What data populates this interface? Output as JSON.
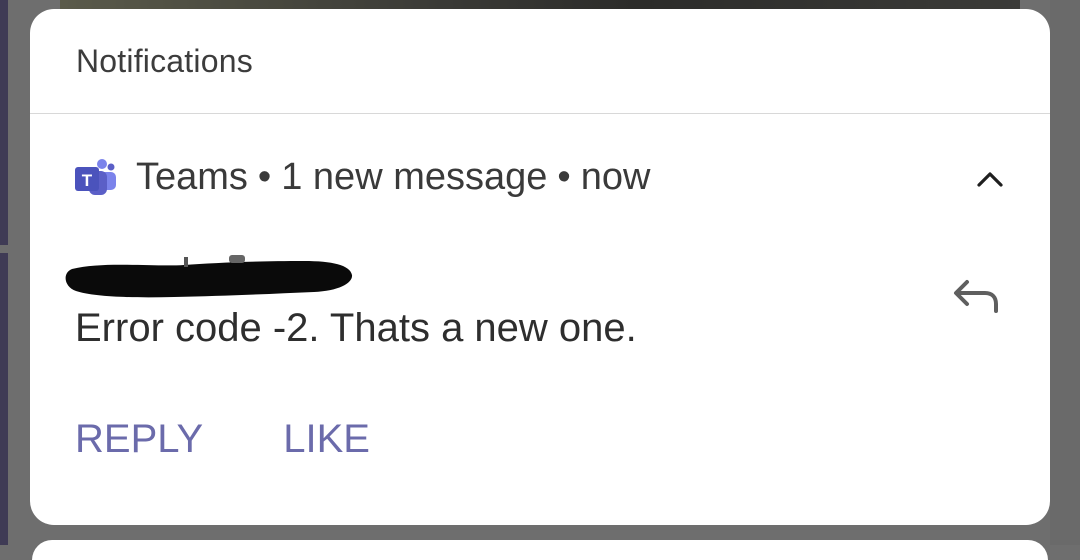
{
  "panel": {
    "title": "Notifications"
  },
  "notification": {
    "app_name": "Teams",
    "separator": "•",
    "summary": "1 new message",
    "time": "now",
    "message": "Error code -2. Thats a new one.",
    "app_icon": "teams-icon",
    "collapse_icon": "chevron-up-icon",
    "reply_icon": "reply-arrow-icon",
    "sender_redacted": true
  },
  "actions": {
    "reply_label": "REPLY",
    "like_label": "LIKE"
  },
  "colors": {
    "accent": "#6b6bab",
    "teams_brand": "#5b5fc7",
    "card_background": "#ffffff",
    "scrim": "#6e6e6e"
  }
}
